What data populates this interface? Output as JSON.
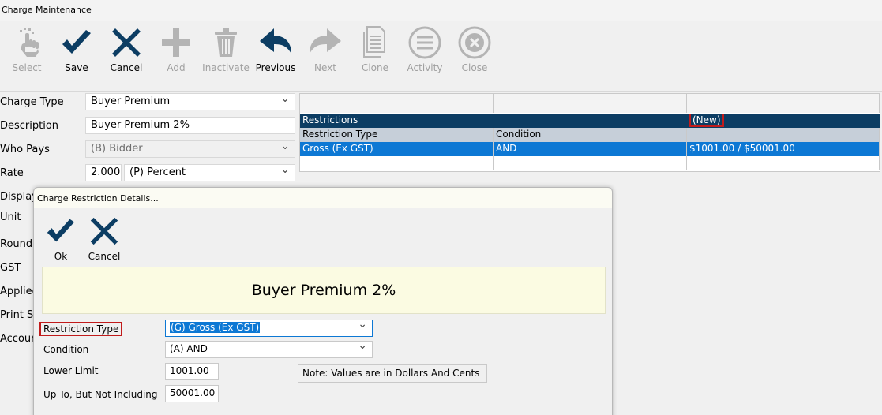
{
  "window": {
    "title": "Charge Maintenance"
  },
  "toolbar": {
    "buttons": [
      {
        "label": "Select",
        "icon": "pointer-hand-icon",
        "enabled": false
      },
      {
        "label": "Save",
        "icon": "checkmark-icon",
        "enabled": true
      },
      {
        "label": "Cancel",
        "icon": "cross-icon",
        "enabled": true
      },
      {
        "label": "Add",
        "icon": "plus-icon",
        "enabled": false
      },
      {
        "label": "Inactivate",
        "icon": "trash-icon",
        "enabled": false
      },
      {
        "label": "Previous",
        "icon": "arrow-back-icon",
        "enabled": true
      },
      {
        "label": "Next",
        "icon": "arrow-forward-icon",
        "enabled": false
      },
      {
        "label": "Clone",
        "icon": "document-copy-icon",
        "enabled": false
      },
      {
        "label": "Activity",
        "icon": "list-icon",
        "enabled": false
      },
      {
        "label": "Close",
        "icon": "close-circle-icon",
        "enabled": false
      }
    ]
  },
  "form": {
    "charge_type_label": "Charge Type",
    "charge_type_value": "Buyer Premium",
    "description_label": "Description",
    "description_value": "Buyer Premium 2%",
    "who_pays_label": "Who Pays",
    "who_pays_value": "(B) Bidder",
    "rate_label": "Rate",
    "rate_value": "2.0000",
    "rate_type_value": "(P) Percent",
    "display_label": "Display",
    "unit_label": "Unit",
    "rounding_label": "Roundi",
    "gst_label": "GST",
    "applied_label": "Applied",
    "print_label": "Print Se",
    "account_label": "Accoun"
  },
  "restrictions_grid": {
    "band_label": "Restrictions",
    "new_label": "(New)",
    "columns": [
      "Restriction Type",
      "Condition"
    ],
    "rows": [
      {
        "restriction_type": "Gross (Ex GST)",
        "condition": "AND",
        "range": "$1001.00 / $50001.00"
      }
    ]
  },
  "dialog": {
    "title": "Charge Restriction Details...",
    "ok_label": "Ok",
    "cancel_label": "Cancel",
    "banner_text": "Buyer Premium 2%",
    "restriction_type_label": "Restriction Type",
    "restriction_type_value": "(G) Gross (Ex GST)",
    "condition_label": "Condition",
    "condition_value": "(A) AND",
    "lower_limit_label": "Lower Limit",
    "lower_limit_value": "1001.00",
    "upper_limit_label": "Up To, But Not Including",
    "upper_limit_value": "50001.00",
    "note_text": "Note: Values are in Dollars And Cents"
  },
  "colors": {
    "accent": "#0c3d63",
    "selection": "#0d78d4",
    "highlight_border": "#c11b1b"
  }
}
